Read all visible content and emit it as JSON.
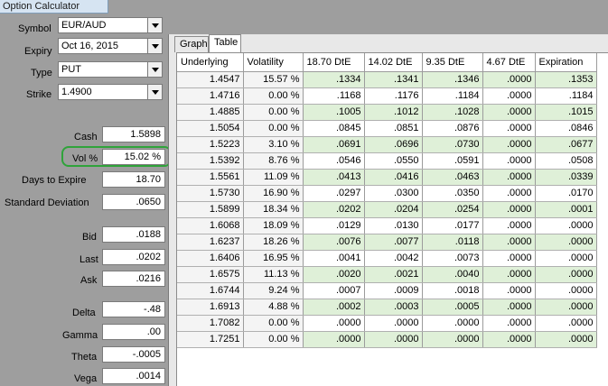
{
  "window": {
    "title": "Option Calculator"
  },
  "form": {
    "symbol": {
      "label": "Symbol",
      "value": "EUR/AUD"
    },
    "expiry": {
      "label": "Expiry",
      "value": "Oct 16, 2015"
    },
    "type": {
      "label": "Type",
      "value": "PUT"
    },
    "strike": {
      "label": "Strike",
      "value": "1.4900"
    },
    "cash": {
      "label": "Cash",
      "value": "1.5898"
    },
    "vol": {
      "label": "Vol %",
      "value": "15.02 %"
    },
    "days_to_expire": {
      "label": "Days to Expire",
      "value": "18.70"
    },
    "std_dev": {
      "label": "Standard Deviation",
      "value": ".0650"
    },
    "bid": {
      "label": "Bid",
      "value": ".0188"
    },
    "last": {
      "label": "Last",
      "value": ".0202"
    },
    "ask": {
      "label": "Ask",
      "value": ".0216"
    },
    "delta": {
      "label": "Delta",
      "value": "-.48"
    },
    "gamma": {
      "label": "Gamma",
      "value": ".00"
    },
    "theta": {
      "label": "Theta",
      "value": "-.0005"
    },
    "vega": {
      "label": "Vega",
      "value": ".0014"
    }
  },
  "tabs": [
    {
      "label": "Graph",
      "active": false
    },
    {
      "label": "Table",
      "active": true
    }
  ],
  "table": {
    "columns": [
      "Underlying",
      "Volatility",
      "18.70 DtE",
      "14.02 DtE",
      "9.35 DtE",
      "4.67 DtE",
      "Expiration"
    ],
    "rows": [
      [
        "1.4547",
        "15.57 %",
        ".1334",
        ".1341",
        ".1346",
        ".0000",
        ".1353"
      ],
      [
        "1.4716",
        "0.00 %",
        ".1168",
        ".1176",
        ".1184",
        ".0000",
        ".1184"
      ],
      [
        "1.4885",
        "0.00 %",
        ".1005",
        ".1012",
        ".1028",
        ".0000",
        ".1015"
      ],
      [
        "1.5054",
        "0.00 %",
        ".0845",
        ".0851",
        ".0876",
        ".0000",
        ".0846"
      ],
      [
        "1.5223",
        "3.10 %",
        ".0691",
        ".0696",
        ".0730",
        ".0000",
        ".0677"
      ],
      [
        "1.5392",
        "8.76 %",
        ".0546",
        ".0550",
        ".0591",
        ".0000",
        ".0508"
      ],
      [
        "1.5561",
        "11.09 %",
        ".0413",
        ".0416",
        ".0463",
        ".0000",
        ".0339"
      ],
      [
        "1.5730",
        "16.90 %",
        ".0297",
        ".0300",
        ".0350",
        ".0000",
        ".0170"
      ],
      [
        "1.5899",
        "18.34 %",
        ".0202",
        ".0204",
        ".0254",
        ".0000",
        ".0001"
      ],
      [
        "1.6068",
        "18.09 %",
        ".0129",
        ".0130",
        ".0177",
        ".0000",
        ".0000"
      ],
      [
        "1.6237",
        "18.26 %",
        ".0076",
        ".0077",
        ".0118",
        ".0000",
        ".0000"
      ],
      [
        "1.6406",
        "16.95 %",
        ".0041",
        ".0042",
        ".0073",
        ".0000",
        ".0000"
      ],
      [
        "1.6575",
        "11.13 %",
        ".0020",
        ".0021",
        ".0040",
        ".0000",
        ".0000"
      ],
      [
        "1.6744",
        "9.24 %",
        ".0007",
        ".0009",
        ".0018",
        ".0000",
        ".0000"
      ],
      [
        "1.6913",
        "4.88 %",
        ".0002",
        ".0003",
        ".0005",
        ".0000",
        ".0000"
      ],
      [
        "1.7082",
        "0.00 %",
        ".0000",
        ".0000",
        ".0000",
        ".0000",
        ".0000"
      ],
      [
        "1.7251",
        "0.00 %",
        ".0000",
        ".0000",
        ".0000",
        ".0000",
        ".0000"
      ]
    ]
  },
  "colors": {
    "highlight_ring": "#2fa33a",
    "cell_green": "#dff0d8"
  }
}
